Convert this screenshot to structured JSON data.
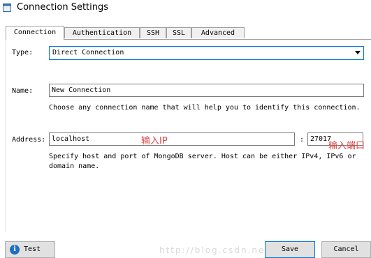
{
  "window": {
    "title": "Connection Settings"
  },
  "tabs": [
    {
      "label": "Connection",
      "active": true
    },
    {
      "label": "Authentication",
      "active": false
    },
    {
      "label": "SSH",
      "active": false
    },
    {
      "label": "SSL",
      "active": false
    },
    {
      "label": "Advanced",
      "active": false
    }
  ],
  "type": {
    "label": "Type:",
    "selected": "Direct Connection"
  },
  "name": {
    "label": "Name:",
    "value": "New Connection",
    "hint": "Choose any connection name that will help you to identify this connection."
  },
  "address": {
    "label": "Address:",
    "host": "localhost",
    "separator": ":",
    "port": "27017",
    "hint_line1": "Specify host and port of MongoDB server. Host can be either IPv4, IPv6 or",
    "hint_line2": "domain name."
  },
  "annotations": {
    "host_note": "输入IP",
    "port_note": "输入端口"
  },
  "buttons": {
    "test": "Test",
    "save": "Save",
    "cancel": "Cancel"
  },
  "watermark": "http://blog.csdn.net/",
  "colors": {
    "annotation": "#e04040",
    "focus_border": "#0078d7",
    "info_icon": "#1d6fc2"
  },
  "icons": {
    "title": "app-icon",
    "test": "info-icon",
    "dropdown": "chevron-down-icon"
  }
}
